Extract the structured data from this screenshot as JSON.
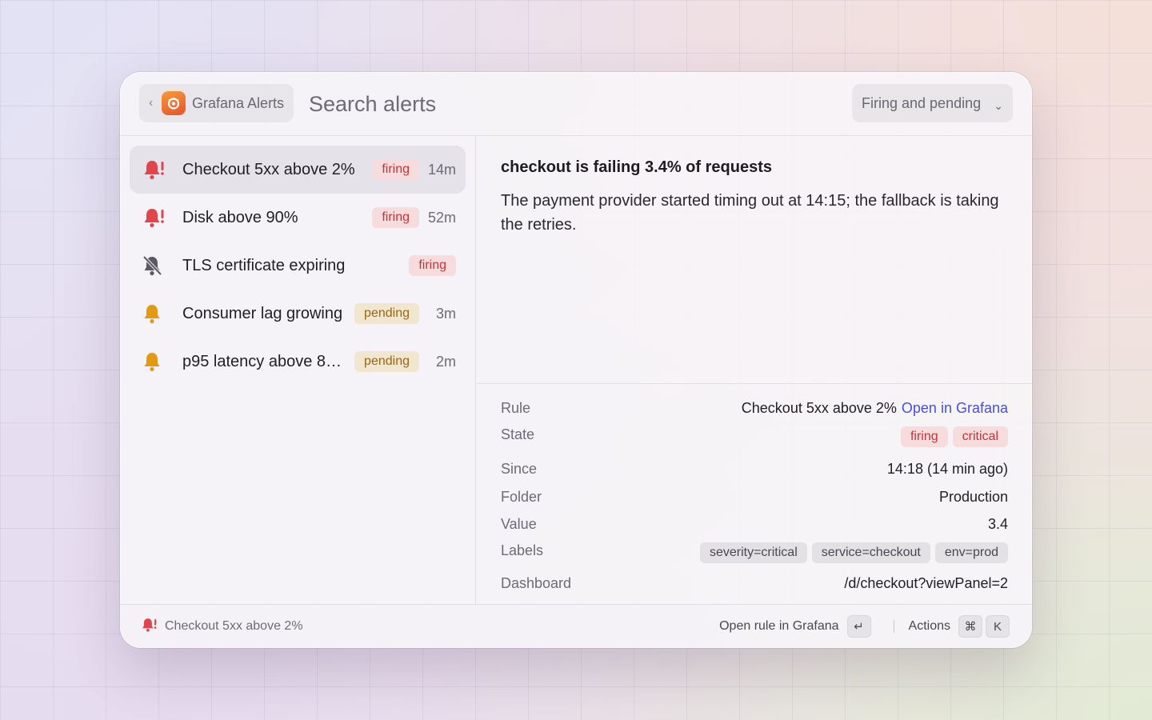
{
  "topbar": {
    "extension_name": "Grafana Alerts",
    "search_placeholder": "Search alerts",
    "filter_label": "Firing and pending"
  },
  "alerts": [
    {
      "title": "Checkout 5xx above 2%",
      "state": "firing",
      "age": "14m",
      "icon": "bell-alert-icon",
      "selected": true
    },
    {
      "title": "Disk above 90%",
      "state": "firing",
      "age": "52m",
      "icon": "bell-alert-icon"
    },
    {
      "title": "TLS certificate expiring",
      "state": "firing",
      "age": "",
      "icon": "bell-muted-icon"
    },
    {
      "title": "Consumer lag growing",
      "state": "pending",
      "age": "3m",
      "icon": "bell-pending-icon"
    },
    {
      "title": "p95 latency above 800ms",
      "state": "pending",
      "age": "2m",
      "icon": "bell-pending-icon"
    }
  ],
  "detail": {
    "heading": "checkout is failing 3.4% of requests",
    "description": "The payment provider started timing out at 14:15; the fallback is taking the retries."
  },
  "metadata": {
    "rule_label": "Rule",
    "rule_value": "Checkout 5xx above 2%",
    "rule_link": "Open in Grafana",
    "state_label": "State",
    "state_tags": [
      "firing",
      "critical"
    ],
    "since_label": "Since",
    "since_value": "14:18 (14 min ago)",
    "folder_label": "Folder",
    "folder_value": "Production",
    "value_label": "Value",
    "value_value": "3.4",
    "labels_label": "Labels",
    "labels_tags": [
      "severity=critical",
      "service=checkout",
      "env=prod"
    ],
    "dashboard_label": "Dashboard",
    "dashboard_link": "/d/checkout?viewPanel=2"
  },
  "footer": {
    "selected_title": "Checkout 5xx above 2%",
    "primary_action": "Open rule in Grafana",
    "primary_key": "↵",
    "actions_label": "Actions",
    "actions_key_1": "⌘",
    "actions_key_2": "K"
  },
  "colors": {
    "firing": "#e0454b",
    "pending": "#e19a12",
    "muted": "#5c5962",
    "link": "#4a4fd6",
    "brand": "#e8532b"
  }
}
